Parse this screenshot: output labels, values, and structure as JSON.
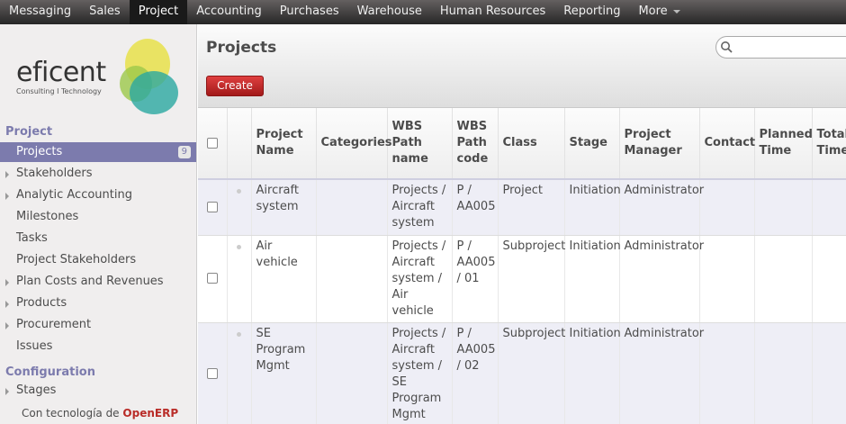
{
  "topbar": {
    "items": [
      {
        "label": "Messaging"
      },
      {
        "label": "Sales"
      },
      {
        "label": "Project",
        "active": true
      },
      {
        "label": "Accounting"
      },
      {
        "label": "Purchases"
      },
      {
        "label": "Warehouse"
      },
      {
        "label": "Human Resources"
      },
      {
        "label": "Reporting"
      },
      {
        "label": "More"
      }
    ]
  },
  "logo": {
    "text": "eficent",
    "subtitle": "Consulting I Technology"
  },
  "sidebar": {
    "section_project": "Project",
    "items": [
      {
        "label": "Projects",
        "badge": "9"
      },
      {
        "label": "Stakeholders"
      },
      {
        "label": "Analytic Accounting"
      },
      {
        "label": "Milestones"
      },
      {
        "label": "Tasks"
      },
      {
        "label": "Project Stakeholders"
      },
      {
        "label": "Plan Costs and Revenues"
      },
      {
        "label": "Products"
      },
      {
        "label": "Procurement"
      },
      {
        "label": "Issues"
      }
    ],
    "section_configuration": "Configuration",
    "config_items": [
      {
        "label": "Stages"
      }
    ],
    "powered_prefix": "Con tecnología de",
    "powered_brand": "OpenERP"
  },
  "main": {
    "title": "Projects",
    "create_label": "Create",
    "search_placeholder": ""
  },
  "table": {
    "headers": {
      "name": "Project Name",
      "categories": "Categories",
      "wbs_name": "WBS Path name",
      "wbs_code": "WBS Path code",
      "class": "Class",
      "stage": "Stage",
      "manager": "Project Manager",
      "contact": "Contact",
      "planned": "Planned Time",
      "total": "Total Time"
    },
    "rows": [
      {
        "name": "Aircraft system",
        "categories": "",
        "wbs_name": "Projects / Aircraft system",
        "wbs_code": "P / AA005",
        "class": "Project",
        "stage": "Initiation",
        "manager": "Administrator",
        "contact": "",
        "planned": "",
        "total": ""
      },
      {
        "name": "Air vehicle",
        "categories": "",
        "wbs_name": "Projects / Aircraft system / Air vehicle",
        "wbs_code": "P / AA005 / 01",
        "class": "Subproject",
        "stage": "Initiation",
        "manager": "Administrator",
        "contact": "",
        "planned": "",
        "total": ""
      },
      {
        "name": "SE Program Mgmt",
        "categories": "",
        "wbs_name": "Projects / Aircraft system / SE Program Mgmt",
        "wbs_code": "P / AA005 / 02",
        "class": "Subproject",
        "stage": "Initiation",
        "manager": "Administrator",
        "contact": "",
        "planned": "",
        "total": ""
      }
    ]
  },
  "colors": {
    "accent": "#7c7bad",
    "create_button": "#c62828",
    "brand_red": "#b92c28"
  }
}
